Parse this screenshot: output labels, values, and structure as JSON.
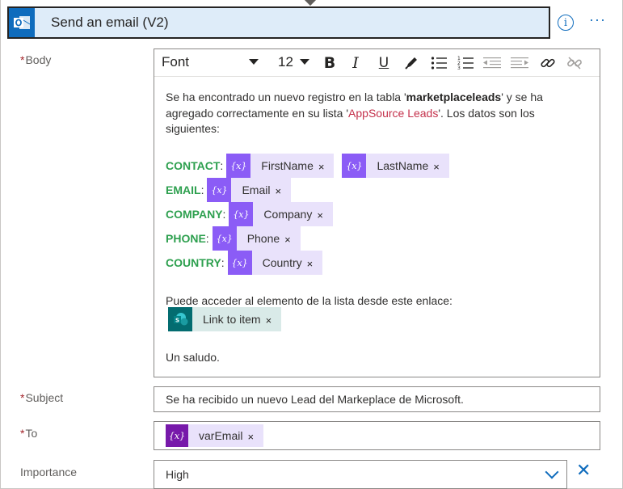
{
  "header": {
    "title": "Send an email (V2)",
    "info_label": "i",
    "more_label": "···"
  },
  "fields": {
    "body_label": "Body",
    "subject_label": "Subject",
    "to_label": "To",
    "importance_label": "Importance",
    "required_mark": "*"
  },
  "toolbar": {
    "font": "Font",
    "size": "12",
    "bold": "B",
    "italic": "I",
    "underline": "U"
  },
  "body": {
    "intro_1": "Se ha encontrado un nuevo registro en la tabla '",
    "table_name": "marketplaceleads",
    "intro_2": "' y se ha agregado correctamente en su lista '",
    "list_name": "AppSource Leads",
    "intro_3": "'. Los datos son los siguientes:",
    "rows": [
      {
        "label": "CONTACT",
        "tokens": [
          "FirstName",
          "LastName"
        ]
      },
      {
        "label": "EMAIL",
        "tokens": [
          "Email"
        ]
      },
      {
        "label": "COMPANY",
        "tokens": [
          "Company"
        ]
      },
      {
        "label": "PHONE",
        "tokens": [
          "Phone"
        ]
      },
      {
        "label": "COUNTRY",
        "tokens": [
          "Country"
        ]
      }
    ],
    "colon": ":",
    "token_icon": "{x}",
    "remove": "×",
    "link_text": "Puede acceder al elemento de la lista desde este enlace:",
    "link_token": "Link to item",
    "closing": "Un saludo."
  },
  "subject": {
    "value": "Se ha recibido un nuevo Lead del Markeplace de Microsoft."
  },
  "to": {
    "token": "varEmail",
    "token_icon": "{x}"
  },
  "importance": {
    "value": "High",
    "clear": "✕"
  },
  "colors": {
    "accent": "#0f6cbd",
    "header_bg": "#deecf9",
    "token_bg": "#e9e2fb",
    "token_icon": "#8b5cf6",
    "variable_icon": "#7719aa",
    "label_green": "#2ea04f",
    "required_red": "#a4262c",
    "sharepoint": "#036c70"
  },
  "icons": [
    "outlook-icon",
    "info-icon",
    "more-icon",
    "bold-icon",
    "italic-icon",
    "underline-icon",
    "pen-icon",
    "bullet-list-icon",
    "numbered-list-icon",
    "decrease-indent-icon",
    "increase-indent-icon",
    "link-icon",
    "unlink-icon",
    "sharepoint-icon",
    "chevron-down-icon",
    "clear-icon"
  ]
}
